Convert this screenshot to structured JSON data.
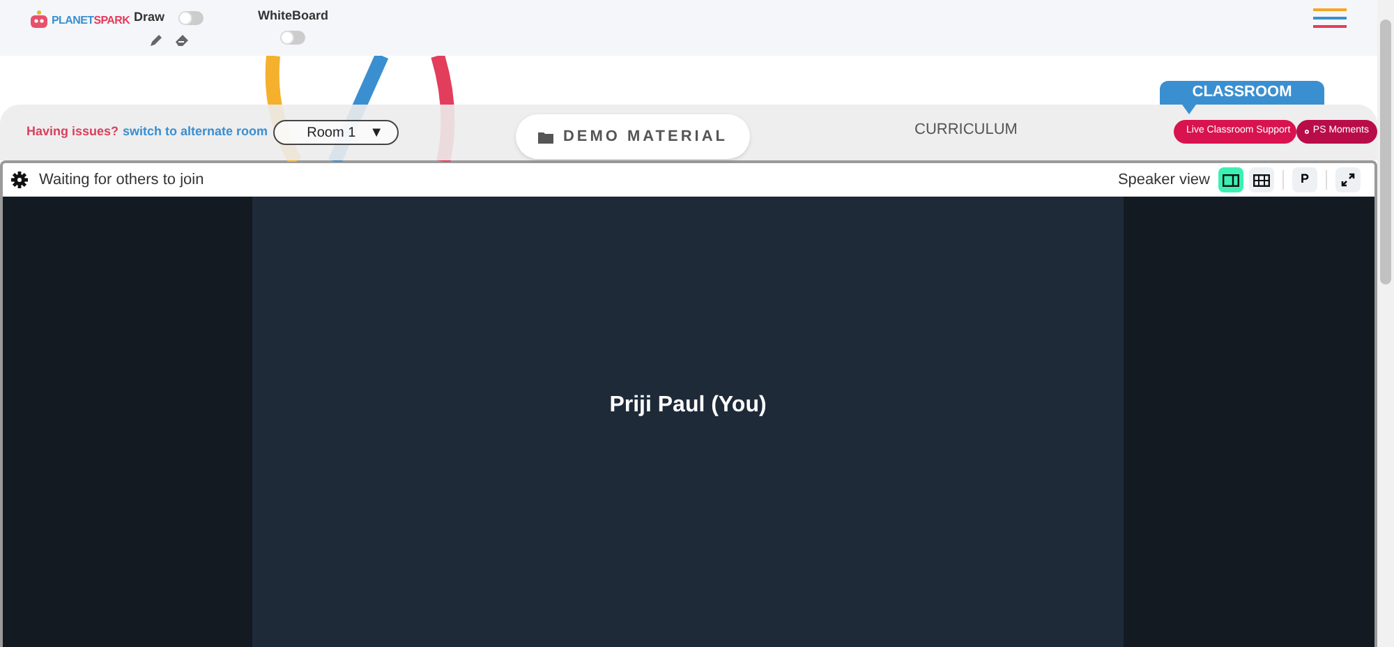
{
  "header": {
    "logo": {
      "part_1": "PLANET",
      "part_2": "SPARK"
    },
    "toggles": [
      {
        "label": "Draw",
        "on": false
      },
      {
        "label": "WhiteBoard",
        "on": false
      }
    ]
  },
  "room_bar": {
    "issue_text": "Having issues?",
    "switch_link": "switch to alternate room",
    "room_select": "Room 1",
    "room_caret": "▼",
    "tabs": [
      {
        "kind": "pill",
        "label": "DEMO MATERIAL",
        "selected": false
      },
      {
        "kind": "text",
        "label": "CURRICULUM",
        "selected": false
      },
      {
        "kind": "flag",
        "label": "CLASSROOM",
        "selected": true
      }
    ],
    "buttons": [
      "Live Classroom Support",
      "PS Moments"
    ]
  },
  "meeting": {
    "status": "Waiting for others to join",
    "view_label": "Speaker view",
    "views": [
      {
        "kind": "speaker",
        "selected": true
      },
      {
        "kind": "grid",
        "selected": false
      }
    ],
    "p_button": "P",
    "participant": "Priji Paul (You)"
  }
}
